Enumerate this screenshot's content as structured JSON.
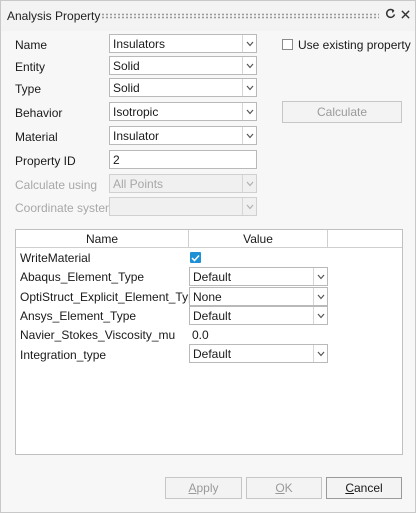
{
  "window": {
    "title": "Analysis Property",
    "refresh_icon": "refresh-icon",
    "close_icon": "close-icon"
  },
  "form": {
    "name": {
      "label": "Name",
      "value": "Insulators"
    },
    "entity": {
      "label": "Entity",
      "value": "Solid"
    },
    "type": {
      "label": "Type",
      "value": "Solid"
    },
    "behavior": {
      "label": "Behavior",
      "value": "Isotropic"
    },
    "material": {
      "label": "Material",
      "value": "Insulator"
    },
    "property_id": {
      "label": "Property ID",
      "value": "2"
    },
    "calculate_using": {
      "label": "Calculate using",
      "value": "All Points"
    },
    "coordinate_system": {
      "label": "Coordinate system",
      "value": ""
    },
    "use_existing": {
      "label": "Use existing property",
      "checked": false
    },
    "calculate_button": "Calculate"
  },
  "table": {
    "headers": [
      "Name",
      "Value"
    ],
    "rows": [
      {
        "name": "WriteMaterial",
        "value": "",
        "kind": "checkbox",
        "checked": true
      },
      {
        "name": "Abaqus_Element_Type",
        "value": "Default",
        "kind": "dropdown"
      },
      {
        "name": "OptiStruct_Explicit_Element_Type",
        "value": "None",
        "kind": "dropdown"
      },
      {
        "name": "Ansys_Element_Type",
        "value": "Default",
        "kind": "dropdown"
      },
      {
        "name": "Navier_Stokes_Viscosity_mu",
        "value": "0.0",
        "kind": "text"
      },
      {
        "name": "Integration_type",
        "value": "Default",
        "kind": "dropdown"
      }
    ]
  },
  "buttons": {
    "apply": {
      "pre": "",
      "ul": "A",
      "post": "pply"
    },
    "ok": {
      "pre": "",
      "ul": "O",
      "post": "K"
    },
    "cancel": {
      "pre": "",
      "ul": "C",
      "post": "ancel"
    }
  },
  "colors": {
    "checkbox_blue": "#1e90d6",
    "disabled_text": "#a8a8a8"
  }
}
